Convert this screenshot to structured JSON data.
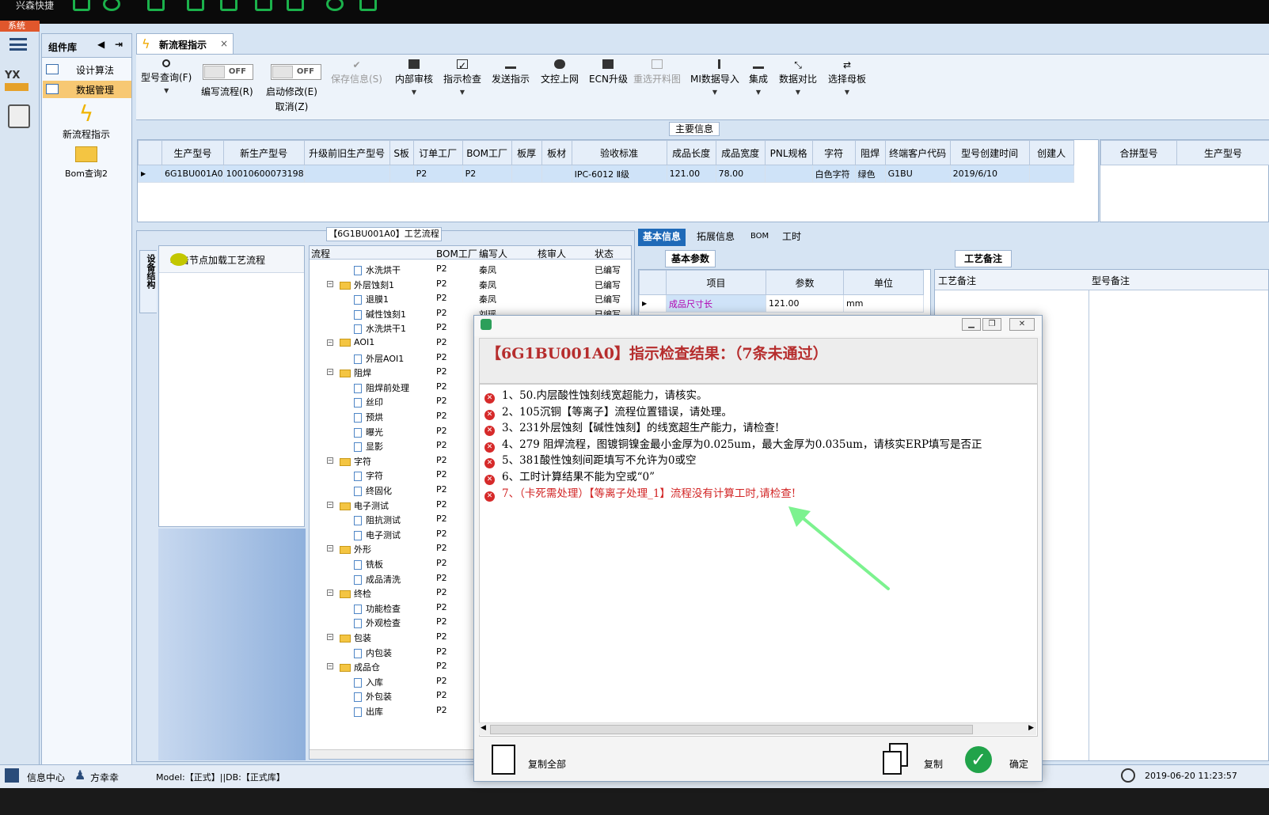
{
  "app": {
    "title": "兴森快捷",
    "sys_label": "系统"
  },
  "colors": {
    "accent": "#1f6ab8",
    "error": "#d22424",
    "selected_nav": "#f7c873",
    "ok": "#21a34a",
    "arrow": "#7cf28f"
  },
  "left_panel": {
    "title": "组件库",
    "items": [
      {
        "label": "设计算法",
        "selected": false
      },
      {
        "label": "数据管理",
        "selected": true
      }
    ],
    "big_items": [
      {
        "label": "新流程指示",
        "icon": "lightning-icon"
      },
      {
        "label": "Bom查询2",
        "icon": "folder-icon"
      }
    ]
  },
  "main_tab": {
    "label": "新流程指示",
    "close": "×"
  },
  "toolbar": {
    "query": "型号查询(F)",
    "toggle_off": "OFF",
    "edit_flow": "编写流程(R)",
    "start_modify": "启动修改(E)",
    "cancel": "取消(Z)",
    "save": "保存信息(S)",
    "internal_review": "内部审核",
    "instruction_check": "指示检查",
    "send_instruction": "发送指示",
    "doc_upload": "文控上网",
    "ecn_upgrade": "ECN升级",
    "reselect_map": "重选开料图",
    "mi_import": "MI数据导入",
    "integrate": "集成",
    "data_compare": "数据对比",
    "select_mother": "选择母板"
  },
  "main_info": {
    "label": "主要信息",
    "columns": [
      "生产型号",
      "新生产型号",
      "升级前旧生产型号",
      "S板",
      "订单工厂",
      "BOM工厂",
      "板厚",
      "板材",
      "验收标准",
      "成品长度",
      "成品宽度",
      "PNL规格",
      "字符",
      "阻焊",
      "终端客户代码",
      "型号创建时间",
      "创建人"
    ],
    "row": [
      "6G1BU001A0",
      "10010600073198",
      "",
      "",
      "P2",
      "P2",
      "",
      "",
      "IPC-6012 Ⅱ级",
      "121.00",
      "78.00",
      "",
      "白色字符",
      "绿色",
      "G1BU",
      "2019/6/10",
      ""
    ],
    "side_columns": [
      "合拼型号",
      "生产型号"
    ]
  },
  "process": {
    "title": "【6G1BU001A0】工艺流程",
    "vertical_tab": "设备结构",
    "load_hint": "单击节点加载工艺流程",
    "columns": [
      "流程",
      "BOM工厂",
      "编写人",
      "核审人",
      "状态"
    ],
    "rows": [
      {
        "name": "水洗烘干",
        "level": 2,
        "factory": "P2",
        "writer": "秦凤",
        "status": "已编写"
      },
      {
        "name": "外层蚀刻1",
        "level": 1,
        "factory": "P2",
        "writer": "秦凤",
        "status": "已编写"
      },
      {
        "name": "退膜1",
        "level": 2,
        "factory": "P2",
        "writer": "秦凤",
        "status": "已编写"
      },
      {
        "name": "碱性蚀刻1",
        "level": 2,
        "factory": "P2",
        "writer": "刘瑶",
        "status": "已编写"
      },
      {
        "name": "水洗烘干1",
        "level": 2,
        "factory": "P2",
        "writer": "",
        "status": ""
      },
      {
        "name": "AOI1",
        "level": 1,
        "factory": "P2",
        "writer": "",
        "status": ""
      },
      {
        "name": "外层AOI1",
        "level": 2,
        "factory": "P2",
        "writer": "",
        "status": ""
      },
      {
        "name": "阻焊",
        "level": 1,
        "factory": "P2",
        "writer": "",
        "status": ""
      },
      {
        "name": "阻焊前处理",
        "level": 2,
        "factory": "P2",
        "writer": "",
        "status": ""
      },
      {
        "name": "丝印",
        "level": 2,
        "factory": "P2",
        "writer": "",
        "status": ""
      },
      {
        "name": "预烘",
        "level": 2,
        "factory": "P2",
        "writer": "",
        "status": ""
      },
      {
        "name": "曝光",
        "level": 2,
        "factory": "P2",
        "writer": "",
        "status": ""
      },
      {
        "name": "显影",
        "level": 2,
        "factory": "P2",
        "writer": "",
        "status": ""
      },
      {
        "name": "字符",
        "level": 1,
        "factory": "P2",
        "writer": "",
        "status": ""
      },
      {
        "name": "字符",
        "level": 2,
        "factory": "P2",
        "writer": "",
        "status": ""
      },
      {
        "name": "终固化",
        "level": 2,
        "factory": "P2",
        "writer": "",
        "status": ""
      },
      {
        "name": "电子测试",
        "level": 1,
        "factory": "P2",
        "writer": "",
        "status": ""
      },
      {
        "name": "阻抗测试",
        "level": 2,
        "factory": "P2",
        "writer": "",
        "status": ""
      },
      {
        "name": "电子测试",
        "level": 2,
        "factory": "P2",
        "writer": "",
        "status": ""
      },
      {
        "name": "外形",
        "level": 1,
        "factory": "P2",
        "writer": "",
        "status": ""
      },
      {
        "name": "铣板",
        "level": 2,
        "factory": "P2",
        "writer": "",
        "status": ""
      },
      {
        "name": "成品清洗",
        "level": 2,
        "factory": "P2",
        "writer": "",
        "status": ""
      },
      {
        "name": "终检",
        "level": 1,
        "factory": "P2",
        "writer": "",
        "status": ""
      },
      {
        "name": "功能检查",
        "level": 2,
        "factory": "P2",
        "writer": "",
        "status": ""
      },
      {
        "name": "外观检查",
        "level": 2,
        "factory": "P2",
        "writer": "",
        "status": ""
      },
      {
        "name": "包装",
        "level": 1,
        "factory": "P2",
        "writer": "",
        "status": ""
      },
      {
        "name": "内包装",
        "level": 2,
        "factory": "P2",
        "writer": "",
        "status": ""
      },
      {
        "name": "成品仓",
        "level": 1,
        "factory": "P2",
        "writer": "",
        "status": ""
      },
      {
        "name": "入库",
        "level": 2,
        "factory": "P2",
        "writer": "",
        "status": ""
      },
      {
        "name": "外包装",
        "level": 2,
        "factory": "P2",
        "writer": "",
        "status": ""
      },
      {
        "name": "出库",
        "level": 2,
        "factory": "P2",
        "writer": "",
        "status": ""
      }
    ]
  },
  "right_panel": {
    "tabs": [
      "基本信息",
      "拓展信息",
      "BOM",
      "工时"
    ],
    "basic_tab": "基本参数",
    "columns": [
      "项目",
      "参数",
      "单位"
    ],
    "row": [
      "成品尺寸长",
      "121.00",
      "mm"
    ],
    "notes_tab": "工艺备注",
    "notes_columns": [
      "工艺备注",
      "型号备注"
    ]
  },
  "dialog": {
    "heading": "【6G1BU001A0】指示检查结果：（7条未通过）",
    "messages": [
      {
        "text": "1、50.内层酸性蚀刻线宽超能力，请核实。",
        "red": false
      },
      {
        "text": "2、105沉铜【等离子】流程位置错误，请处理。",
        "red": false
      },
      {
        "text": "3、231外层蚀刻【碱性蚀刻】的线宽超生产能力，请检查!",
        "red": false
      },
      {
        "text": "4、279 阻焊流程，图镀铜镍金最小金厚为0.025um，最大金厚为0.035um，请核实ERP填写是否正",
        "red": false
      },
      {
        "text": "5、381酸性蚀刻间距填写不允许为0或空",
        "red": false
      },
      {
        "text": "6、工时计算结果不能为空或“0”",
        "red": false
      },
      {
        "text": "7、（卡死需处理）【等离子处理_1】流程没有计算工时,请检查!",
        "red": true
      }
    ],
    "copy_all": "复制全部",
    "copy": "复制",
    "ok": "确定"
  },
  "status_bar": {
    "info_center": "信息中心",
    "user": "方幸幸",
    "model": "Model:【正式】||DB:【正式库】",
    "time": "2019-06-20 11:23:57"
  }
}
